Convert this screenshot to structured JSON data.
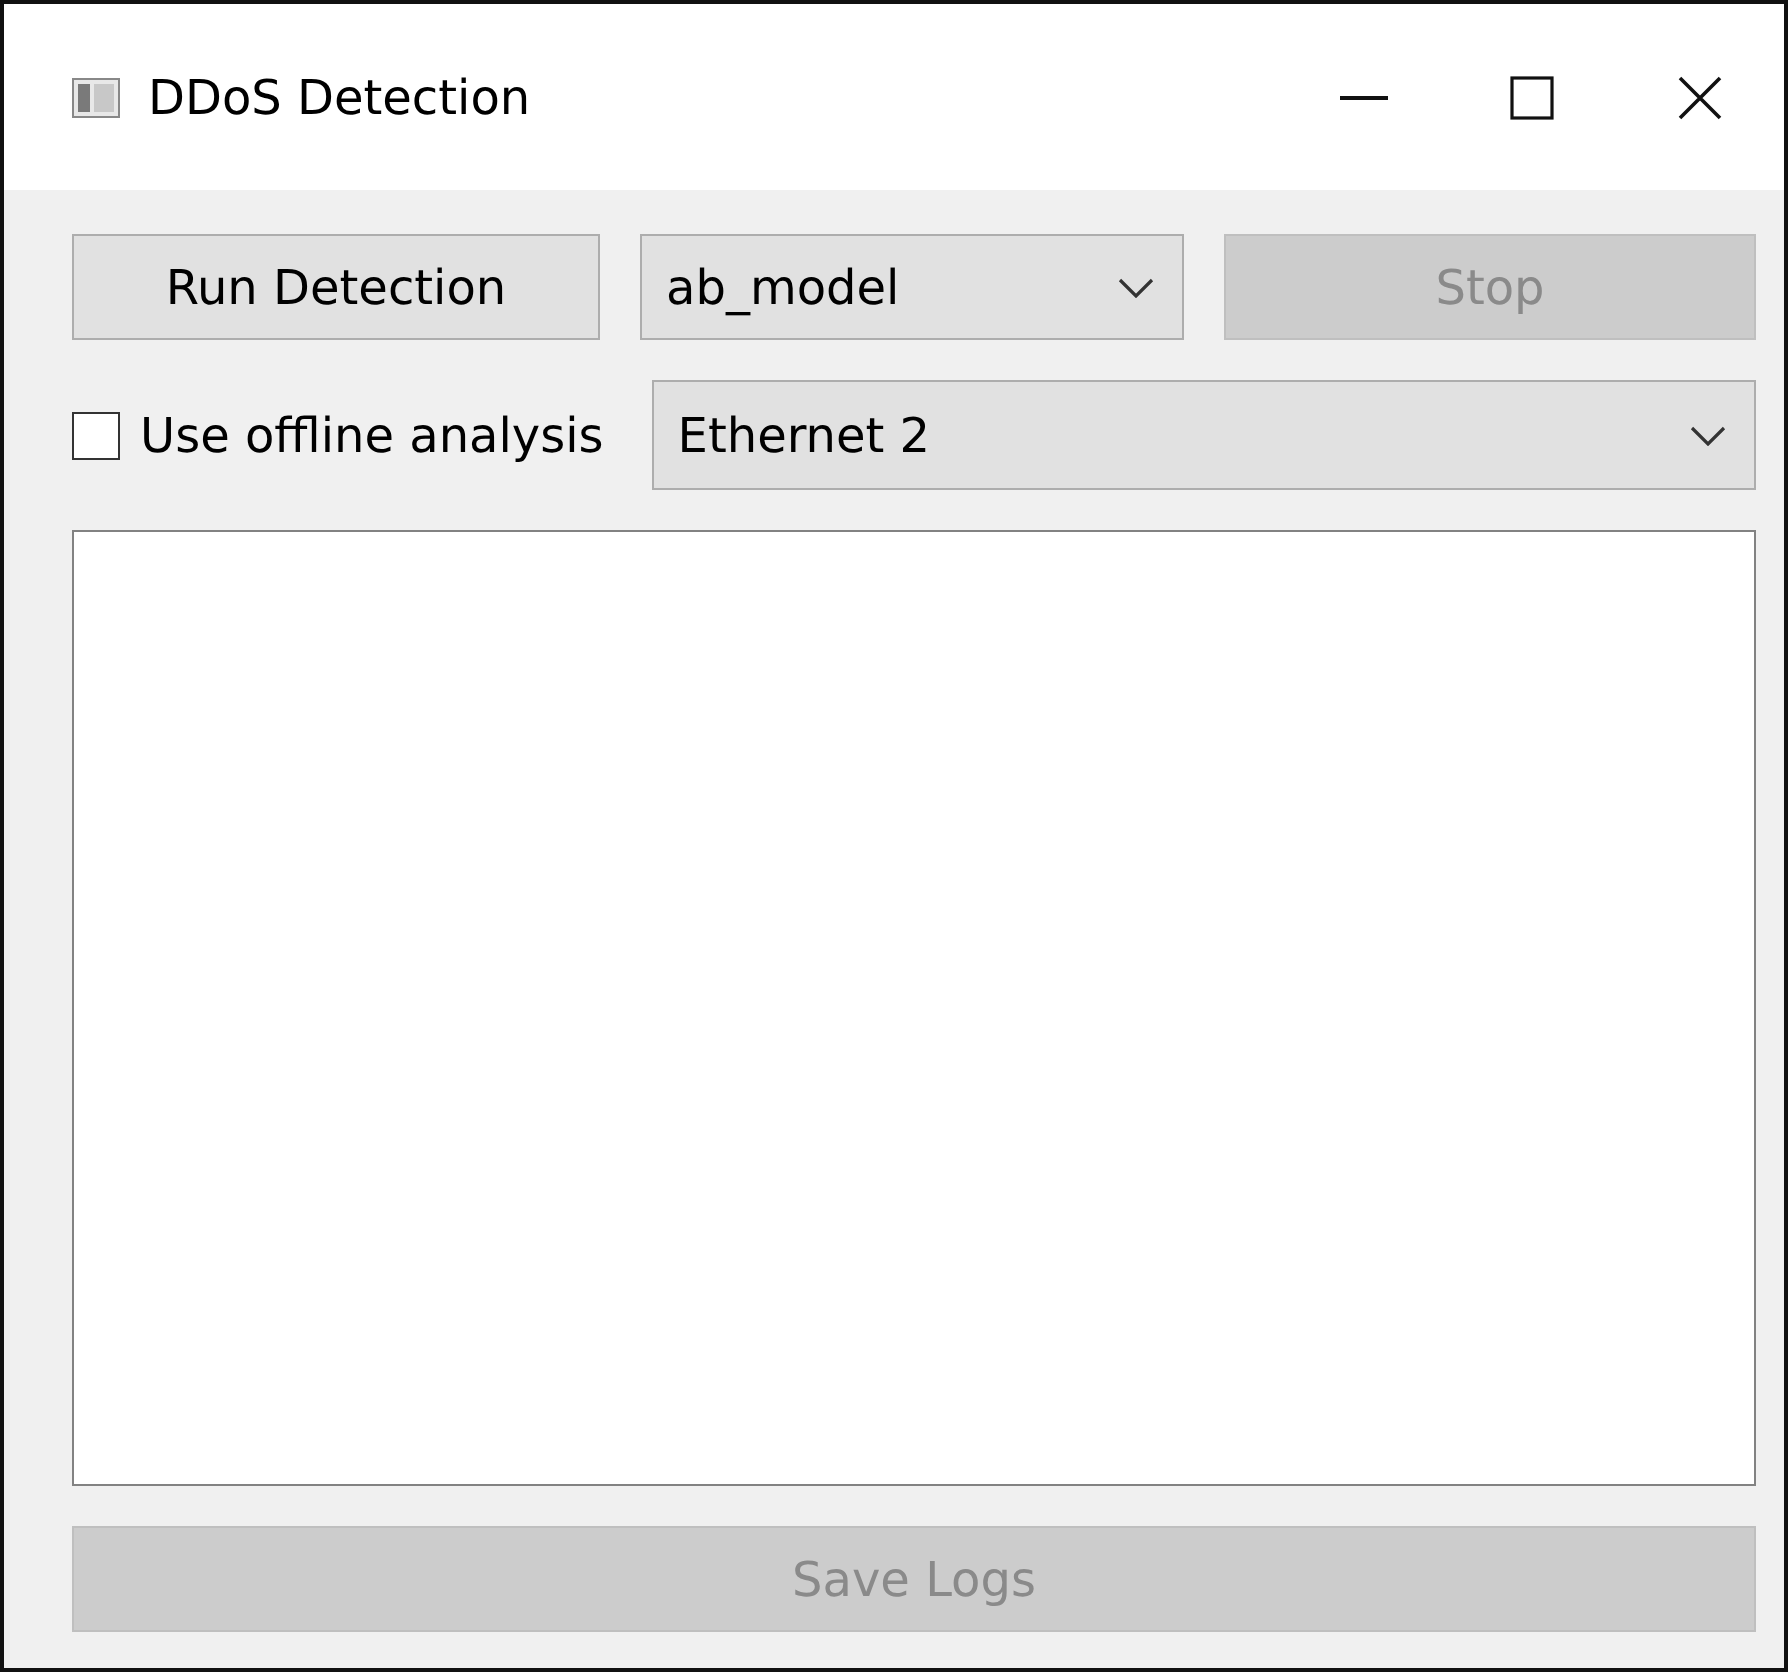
{
  "window": {
    "title": "DDoS Detection"
  },
  "toolbar": {
    "run_button": {
      "label": "Run Detection",
      "disabled": false
    },
    "model_select": {
      "value": "ab_model"
    },
    "stop_button": {
      "label": "Stop",
      "disabled": true
    }
  },
  "options": {
    "offline_checkbox": {
      "label": "Use offline analysis",
      "checked": false
    },
    "interface_select": {
      "value": "Ethernet 2"
    }
  },
  "save_button": {
    "label": "Save Logs",
    "disabled": true
  }
}
